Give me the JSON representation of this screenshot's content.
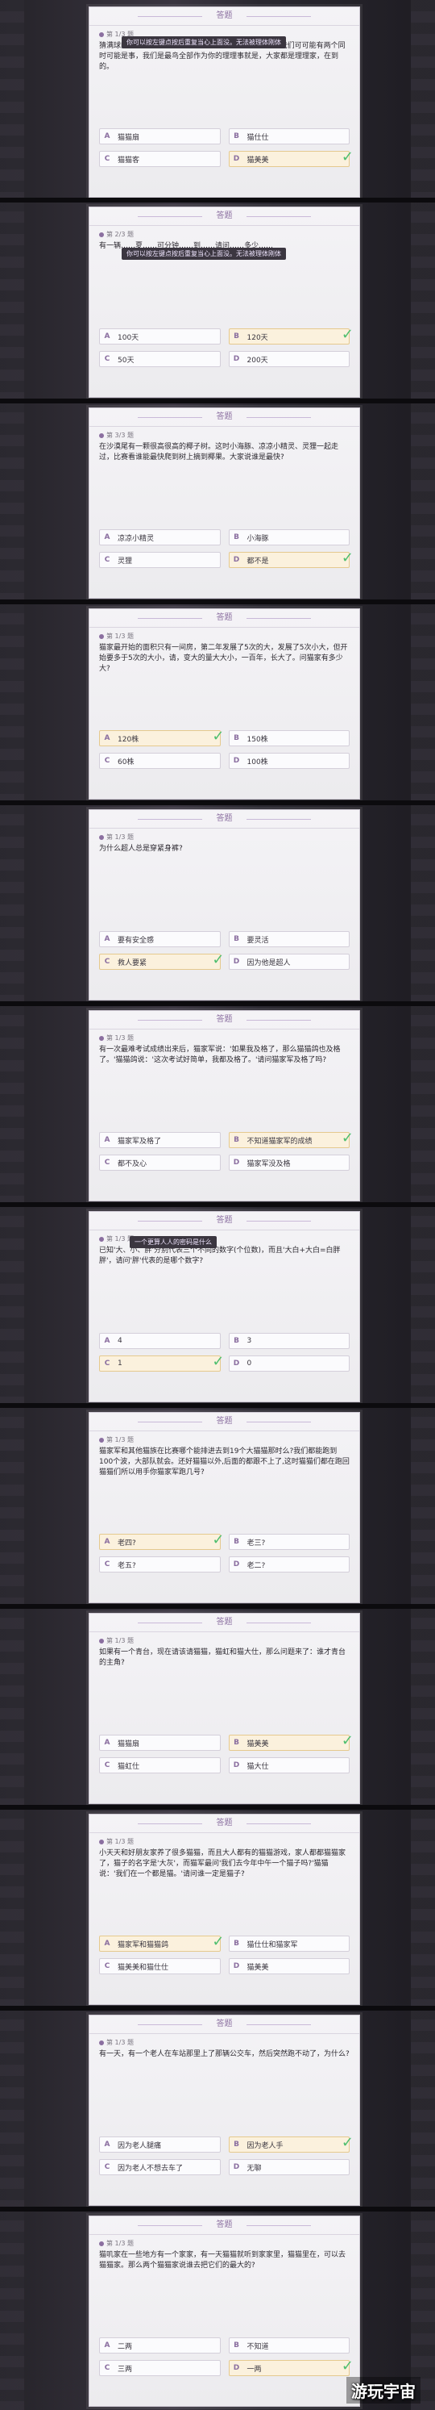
{
  "header_label": "答题",
  "cards": [
    {
      "num": "第 1/3 题",
      "question": "猜满球的鸽鸽人辅中了。那你来快了到人A的30大夏了。我们可可能有两个同时可能是事，我们是最鸟全部作为你的理理事就是，大家都是理理家，在到的。",
      "tip": "你可以按左键点按后重复当心上面没。无法被理体刚体",
      "options": [
        {
          "letter": "A",
          "text": "猫猫扇"
        },
        {
          "letter": "B",
          "text": "猫仕仕"
        },
        {
          "letter": "C",
          "text": "猫猫客"
        },
        {
          "letter": "D",
          "text": "猫美美"
        }
      ],
      "correct": 3
    },
    {
      "num": "第 2/3 题",
      "question": "有一辆……夏……可分钟……到……请问……多少……",
      "tip": "你可以按左键点按后重复当心上面没。无法被理体刚体",
      "options": [
        {
          "letter": "A",
          "text": "100天"
        },
        {
          "letter": "B",
          "text": "120天"
        },
        {
          "letter": "C",
          "text": "50天"
        },
        {
          "letter": "D",
          "text": "200天"
        }
      ],
      "correct": 1
    },
    {
      "num": "第 3/3 题",
      "question": "在沙漠尾有一颗很高很高的椰子树。这时小海豚、凉凉小精灵、灵狸一起走过，比赛看谁能最快爬到树上摘到椰果。大家说谁是最快?",
      "options": [
        {
          "letter": "A",
          "text": "凉凉小精灵"
        },
        {
          "letter": "B",
          "text": "小海豚"
        },
        {
          "letter": "C",
          "text": "灵狸"
        },
        {
          "letter": "D",
          "text": "都不是"
        }
      ],
      "correct": 3
    },
    {
      "num": "第 1/3 题",
      "question": "猫家最开始的面积只有一间房，第二年发展了5次的大，发展了5次小大，但开始要多于5次的大小，请，变大的量大大小，一百年，长大了。问猫家有多少大?",
      "options": [
        {
          "letter": "A",
          "text": "120株"
        },
        {
          "letter": "B",
          "text": "150株"
        },
        {
          "letter": "C",
          "text": "60株"
        },
        {
          "letter": "D",
          "text": "100株"
        }
      ],
      "correct": 0
    },
    {
      "num": "第 1/3 题",
      "question": "为什么超人总是穿紧身裤?",
      "options": [
        {
          "letter": "A",
          "text": "要有安全感"
        },
        {
          "letter": "B",
          "text": "要灵活"
        },
        {
          "letter": "C",
          "text": "救人要紧"
        },
        {
          "letter": "D",
          "text": "因为他是超人"
        }
      ],
      "correct": 2
    },
    {
      "num": "第 1/3 题",
      "question": "有一次最难考试成绩出来后，猫家军说：'如果我及格了，那么猫猫鸽也及格了。'猫猫鸽说：'这次考试好简单，我都及格了。'请问猫家军及格了吗?",
      "options": [
        {
          "letter": "A",
          "text": "猫家军及格了"
        },
        {
          "letter": "B",
          "text": "不知道猫家军的成绩"
        },
        {
          "letter": "C",
          "text": "都不及心"
        },
        {
          "letter": "D",
          "text": "猫家军没及格"
        }
      ],
      "correct": 1
    },
    {
      "num": "第 1/3 题",
      "question": "已知'大、小、胖'分别代表三个不同的数字(个位数)，而且'大白+大白=白胖胖'，请问'胖'代表的是哪个数字?",
      "tip": "一个更算人人的密码是什么",
      "options": [
        {
          "letter": "A",
          "text": "4"
        },
        {
          "letter": "B",
          "text": "3"
        },
        {
          "letter": "C",
          "text": "1"
        },
        {
          "letter": "D",
          "text": "0"
        }
      ],
      "correct": 2
    },
    {
      "num": "第 1/3 题",
      "question": "猫家军和其他猫族在比赛哪个能排进去到19个大猫猫那时么?我们都能跑到100个波，大部队就会。还好猫猫以外,后面的都跟不上了,这时猫猫们都在跑回猫猫们所以用手你猫家军跑几号?",
      "options": [
        {
          "letter": "A",
          "text": "老四?"
        },
        {
          "letter": "B",
          "text": "老三?"
        },
        {
          "letter": "C",
          "text": "老五?"
        },
        {
          "letter": "D",
          "text": "老二?"
        }
      ],
      "correct": 0
    },
    {
      "num": "第 1/3 题",
      "question": "如果有一个青台，现在请该请猫猫，猫虹和猫大仕，那么问题来了：谁才青台的主角?",
      "options": [
        {
          "letter": "A",
          "text": "猫猫扇"
        },
        {
          "letter": "B",
          "text": "猫美美"
        },
        {
          "letter": "C",
          "text": "猫虹仕"
        },
        {
          "letter": "D",
          "text": "猫大仕"
        }
      ],
      "correct": 1
    },
    {
      "num": "第 1/3 题",
      "question": "小天天和好朋友家养了很多猫猫，而且大人都有的猫猫游戏，家人都都猫猫家了，猫子的名字是'大灰'，而猫军最问'我们去今年中午一个猫子吗?'猫猫说：'我们在一个都是猫。'请问谁一定是猫子?",
      "options": [
        {
          "letter": "A",
          "text": "猫家军和猫猫鸽"
        },
        {
          "letter": "B",
          "text": "猫仕仕和猫家军"
        },
        {
          "letter": "C",
          "text": "猫美美和猫仕仕"
        },
        {
          "letter": "D",
          "text": "猫美美"
        }
      ],
      "correct": 0
    },
    {
      "num": "第 1/3 题",
      "question": "有一天，有一个老人在车站那里上了那辆公交车，然后突然跑不动了，为什么?",
      "options": [
        {
          "letter": "A",
          "text": "因为老人腿痛"
        },
        {
          "letter": "B",
          "text": "因为老人手"
        },
        {
          "letter": "C",
          "text": "因为老人不想去车了"
        },
        {
          "letter": "D",
          "text": "无聊"
        }
      ],
      "correct": 1
    },
    {
      "num": "第 1/3 题",
      "question": "猫叽家在一些地方有一个家家，有一天猫猫就听到家家里，猫猫里在，可以去猫猫家。那么两个猫猫家说谁去把它们的最大的?",
      "options": [
        {
          "letter": "A",
          "text": "二两"
        },
        {
          "letter": "B",
          "text": "不知道"
        },
        {
          "letter": "C",
          "text": "三两"
        },
        {
          "letter": "D",
          "text": "一两"
        }
      ],
      "correct": 3
    }
  ],
  "watermark": "游玩宇宙"
}
